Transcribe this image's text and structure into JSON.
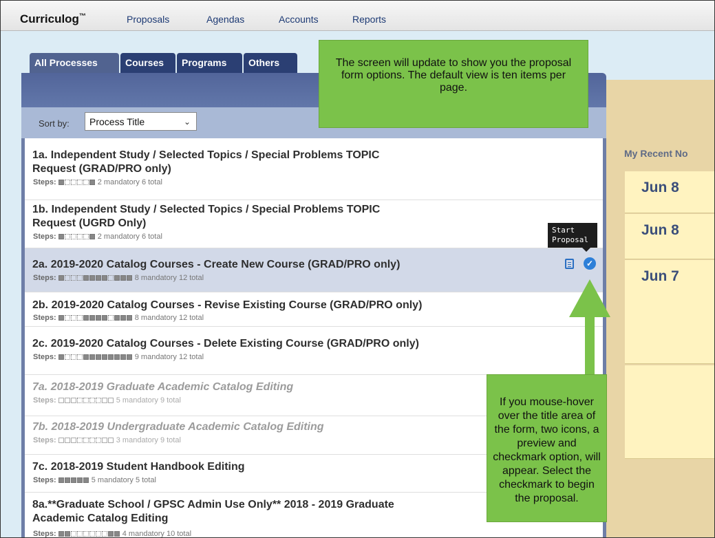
{
  "app": {
    "name": "Curriculog",
    "trademark": "™"
  },
  "nav": [
    {
      "label": "Proposals"
    },
    {
      "label": "Agendas"
    },
    {
      "label": "Accounts"
    },
    {
      "label": "Reports"
    }
  ],
  "tabs": [
    {
      "label": "All Processes",
      "active": true
    },
    {
      "label": "Courses",
      "active": false
    },
    {
      "label": "Programs",
      "active": false
    },
    {
      "label": "Others",
      "active": false
    }
  ],
  "sort": {
    "label": "Sort by:",
    "selected": "Process Title"
  },
  "steps_label": "Steps:",
  "processes": [
    {
      "title_line1": "1a. Independent Study / Selected Topics / Special Problems TOPIC",
      "title_line2": "Request (GRAD/PRO only)",
      "steps_text": "2 mandatory 6 total",
      "active": true
    },
    {
      "title_line1": "1b. Independent Study / Selected Topics / Special Problems TOPIC",
      "title_line2": "Request (UGRD Only)",
      "steps_text": "2 mandatory 6 total",
      "active": true
    },
    {
      "title_line1": "2a. 2019-2020 Catalog Courses - Create New Course (GRAD/PRO only)",
      "steps_text": "8 mandatory 12 total",
      "active": true,
      "highlighted": true
    },
    {
      "title_line1": "2b. 2019-2020 Catalog Courses - Revise Existing Course (GRAD/PRO only)",
      "steps_text": "8 mandatory 12 total",
      "active": true
    },
    {
      "title_line1": "2c. 2019-2020 Catalog Courses - Delete Existing Course (GRAD/PRO only)",
      "steps_text": "9 mandatory 12 total",
      "active": true
    },
    {
      "title_line1": "7a. 2018-2019 Graduate Academic Catalog Editing",
      "steps_text": "5 mandatory 9 total",
      "active": false
    },
    {
      "title_line1": "7b. 2018-2019 Undergraduate Academic Catalog Editing",
      "steps_text": "3 mandatory 9 total",
      "active": false
    },
    {
      "title_line1": "7c. 2018-2019 Student Handbook Editing",
      "steps_text": "5 mandatory 5 total",
      "active": true
    },
    {
      "title_line1": "8a.**Graduate School / GPSC Admin Use Only** 2018 - 2019 Graduate",
      "title_line2": "Academic Catalog Editing",
      "steps_text": "4 mandatory 10 total",
      "active": true
    }
  ],
  "tooltip": {
    "line1": "Start",
    "line2": "Proposal"
  },
  "recent": {
    "title": "My Recent No",
    "dates": [
      "Jun 8",
      "Jun 8",
      "Jun 7"
    ]
  },
  "callouts": {
    "top": "The screen will update to show you the proposal form options. The default view is ten items per page.",
    "bottom": "If you mouse-hover over the title area of the form, two icons, a preview and checkmark option, will appear. Select the checkmark to begin the  proposal."
  },
  "colors": {
    "accent_green": "#7bc24a",
    "tab_active": "#516390",
    "tab_inactive": "#2b3f73",
    "check_blue": "#2d7fd8"
  }
}
